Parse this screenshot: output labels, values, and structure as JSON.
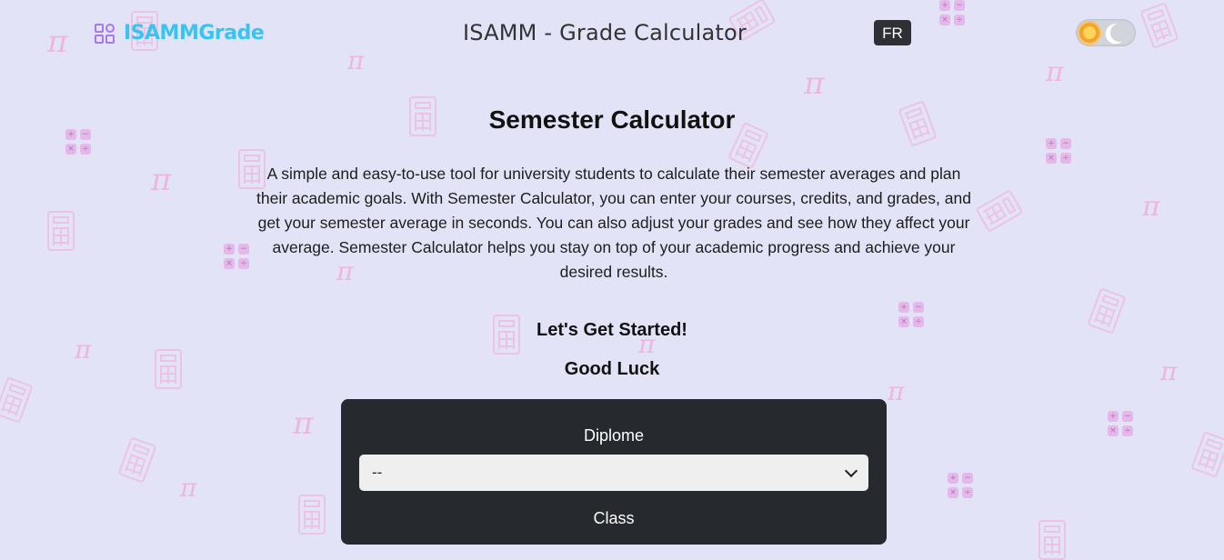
{
  "header": {
    "logo_text": "ISAMMGrade",
    "title": "ISAMM - Grade Calculator",
    "lang_button": "FR"
  },
  "main": {
    "heading": "Semester Calculator",
    "description": "A simple and easy-to-use tool for university students to calculate their semester averages and plan their academic goals. With Semester Calculator, you can enter your courses, credits, and grades, and get your semester average in seconds. You can also adjust your grades and see how they affect your average. Semester Calculator helps you stay on top of your academic progress and achieve your desired results.",
    "subheading_1": "Let's Get Started!",
    "subheading_2": "Good Luck"
  },
  "form": {
    "diplome_label": "Diplome",
    "diplome_selected": "--",
    "class_label": "Class"
  },
  "colors": {
    "background": "#e2e3f6",
    "logo_text": "#38c4f0",
    "logo_icon": "#a779e9",
    "card": "#26292e",
    "decoration": "#ecb6e0"
  },
  "icons": {
    "logo": "grid-logo-icon",
    "theme_light": "sun-icon",
    "theme_dark": "moon-icon",
    "select_arrow": "chevron-down-icon"
  }
}
